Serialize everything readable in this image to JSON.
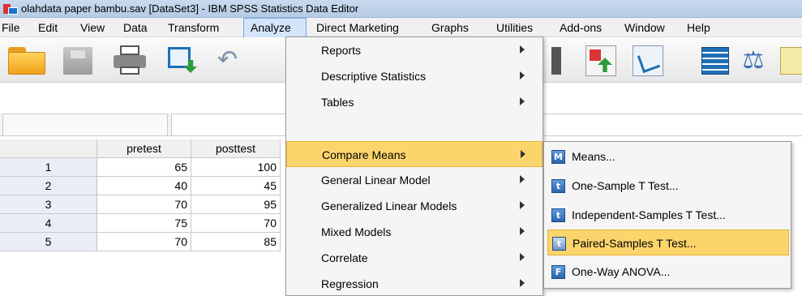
{
  "window": {
    "title": "olahdata paper bambu.sav [DataSet3] - IBM SPSS Statistics Data Editor"
  },
  "menubar": {
    "items": [
      "File",
      "Edit",
      "View",
      "Data",
      "Transform",
      "Analyze",
      "Direct Marketing",
      "Graphs",
      "Utilities",
      "Add-ons",
      "Window",
      "Help"
    ],
    "active": "Analyze"
  },
  "grid": {
    "columns": [
      "pretest",
      "posttest"
    ],
    "rows": [
      {
        "num": "1",
        "pretest": "65",
        "posttest": "100"
      },
      {
        "num": "2",
        "pretest": "40",
        "posttest": "45"
      },
      {
        "num": "3",
        "pretest": "70",
        "posttest": "95"
      },
      {
        "num": "4",
        "pretest": "75",
        "posttest": "70"
      },
      {
        "num": "5",
        "pretest": "70",
        "posttest": "85"
      }
    ]
  },
  "analyze_menu": {
    "items": [
      "Reports",
      "Descriptive Statistics",
      "Tables",
      "Compare Means",
      "General Linear Model",
      "Generalized Linear Models",
      "Mixed Models",
      "Correlate",
      "Regression"
    ],
    "highlighted": "Compare Means"
  },
  "compare_means_submenu": {
    "items": [
      {
        "label": "Means...",
        "icon": "M"
      },
      {
        "label": "One-Sample T Test...",
        "icon": "t"
      },
      {
        "label": "Independent-Samples T Test...",
        "icon": "t"
      },
      {
        "label": "Paired-Samples T Test...",
        "icon": "t"
      },
      {
        "label": "One-Way ANOVA...",
        "icon": "F"
      }
    ],
    "highlighted": "Paired-Samples T Test..."
  },
  "colors": {
    "highlight": "#fbd56c",
    "titlebar": "#c9d9ee",
    "menu_active": "#d4e5fa"
  }
}
